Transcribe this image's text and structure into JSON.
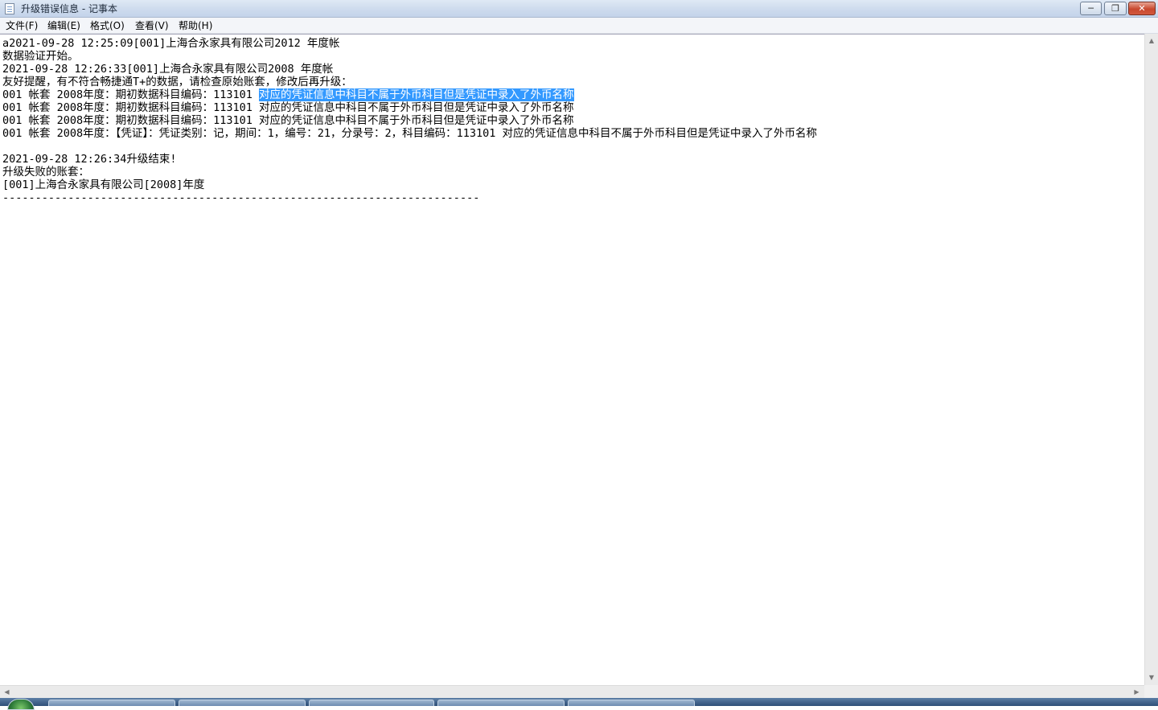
{
  "window": {
    "title": "升级错误信息 - 记事本",
    "minimize_glyph": "─",
    "maximize_glyph": "❐",
    "close_glyph": "✕"
  },
  "menu": {
    "file": "文件(F)",
    "edit": "编辑(E)",
    "format": "格式(O)",
    "view": "查看(V)",
    "help": "帮助(H)"
  },
  "content": {
    "lines": [
      "a2021-09-28 12:25:09[001]上海合永家具有限公司2012 年度帐",
      "数据验证开始。",
      "2021-09-28 12:26:33[001]上海合永家具有限公司2008 年度帐",
      "友好提醒，有不符合畅捷通T+的数据，请检查原始账套，修改后再升级：",
      "001 帐套 2008年度：期初数据科目编码：113101 ",
      "001 帐套 2008年度：期初数据科目编码：113101 对应的凭证信息中科目不属于外币科目但是凭证中录入了外币名称",
      "001 帐套 2008年度：期初数据科目编码：113101 对应的凭证信息中科目不属于外币科目但是凭证中录入了外币名称",
      "001 帐套 2008年度：【凭证】：凭证类别：记，期间：1，编号：21，分录号：2，科目编码：113101 对应的凭证信息中科目不属于外币科目但是凭证中录入了外币名称",
      "",
      "2021-09-28 12:26:34升级结束!",
      "升级失败的账套：",
      "[001]上海合永家具有限公司[2008]年度",
      "-------------------------------------------------------------------------"
    ],
    "selected_text": "对应的凭证信息中科目不属于外币科目但是凭证中录入了外币名称"
  },
  "scrollbar": {
    "up_glyph": "▲",
    "down_glyph": "▼",
    "left_glyph": "◀",
    "right_glyph": "▶"
  }
}
